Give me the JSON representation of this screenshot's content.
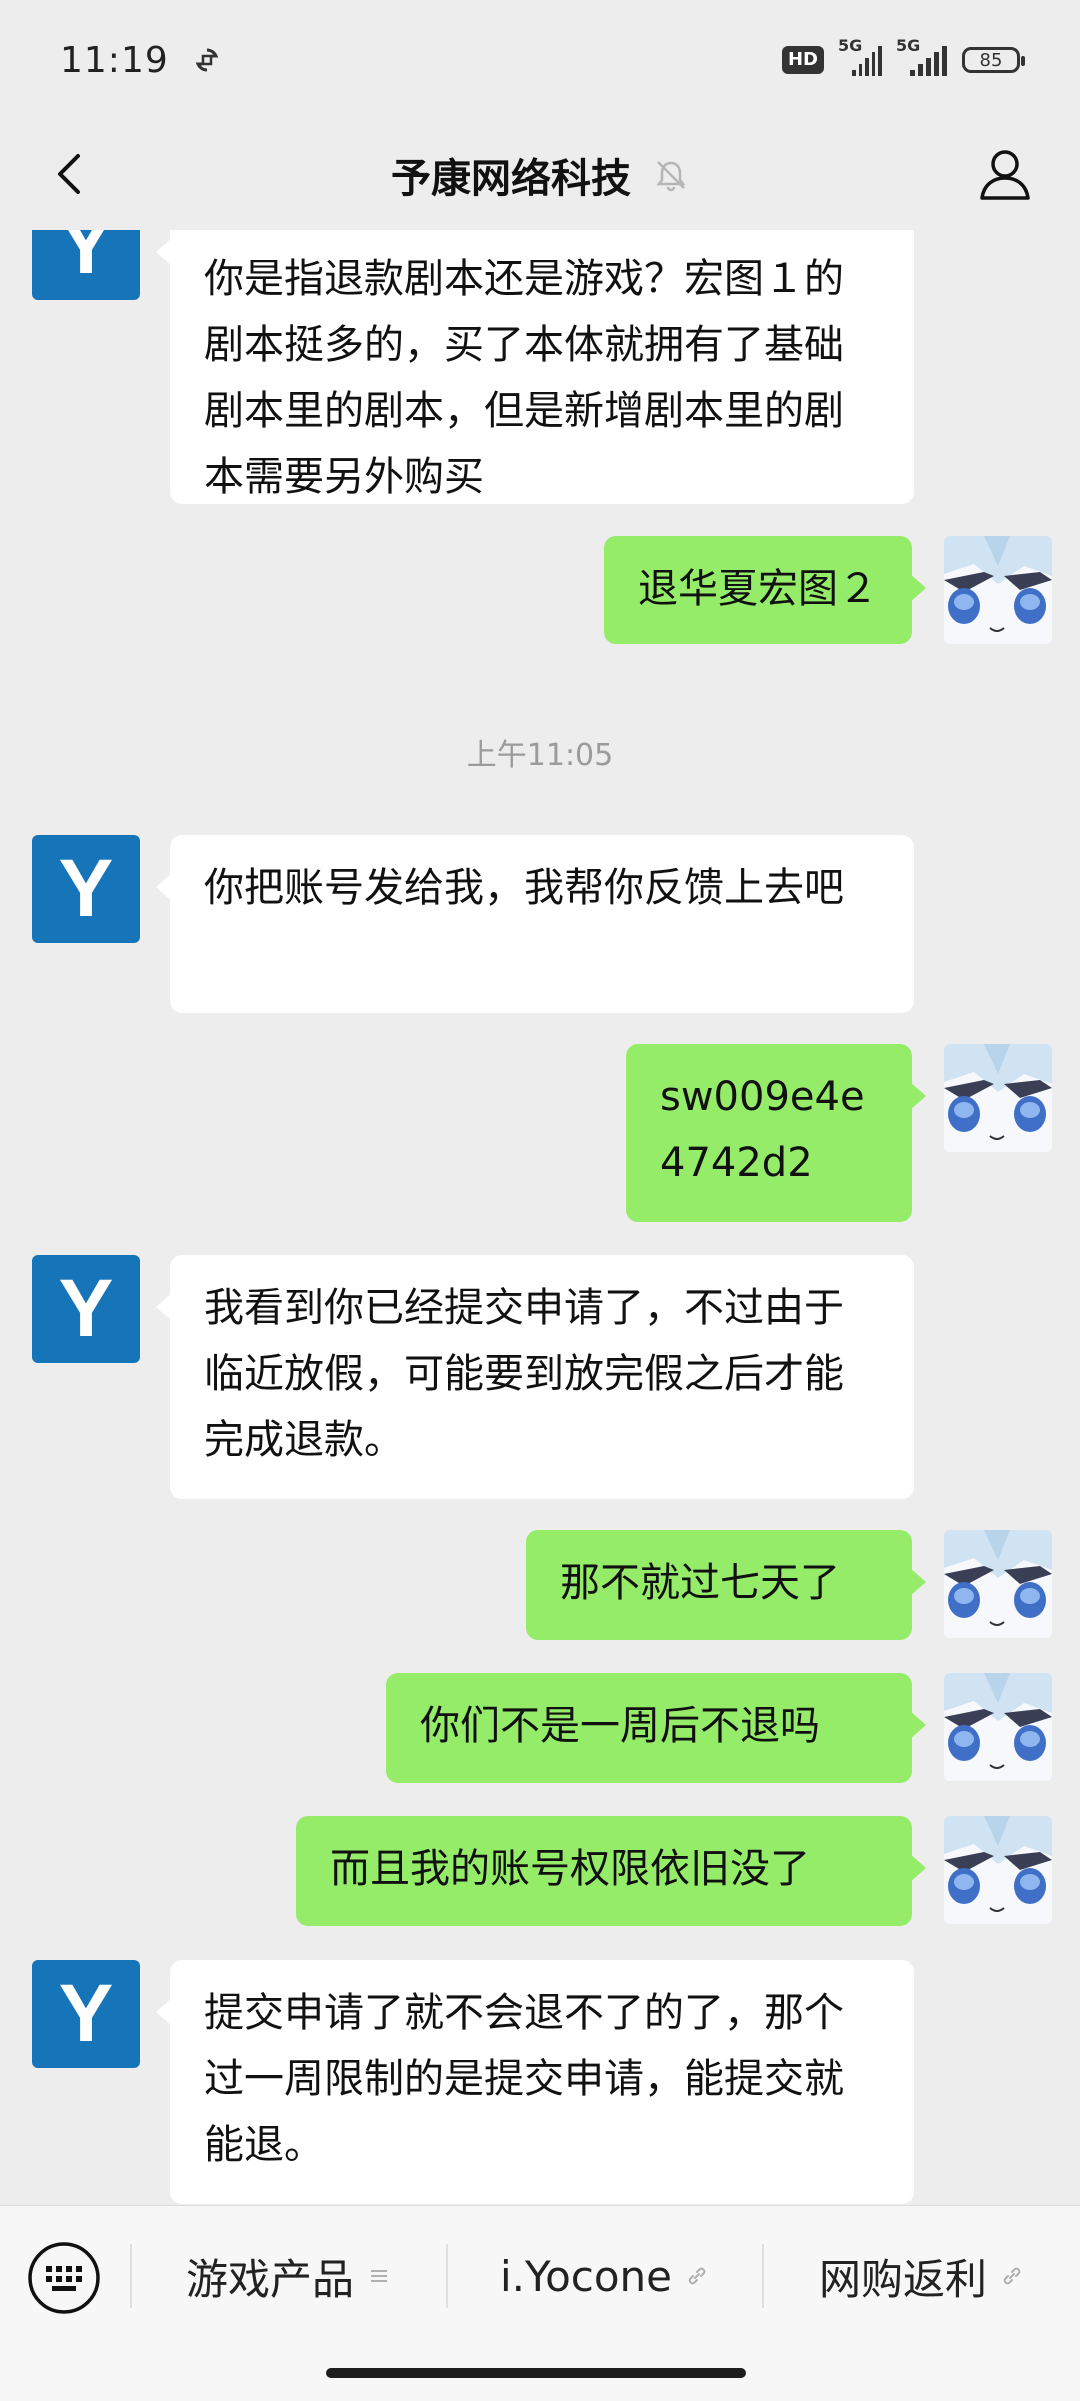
{
  "status_bar": {
    "time": "11:19",
    "hd_label": "HD",
    "sim1_label": "5G",
    "sim2_label": "5G",
    "battery": "85"
  },
  "nav": {
    "title": "予康网络科技"
  },
  "messages": [
    {
      "side": "in",
      "text": "你是指退款剧本还是游戏？宏图１的剧本挺多的，买了本体就拥有了基础剧本里的剧本，但是新增剧本里的剧本需要另外购买"
    },
    {
      "side": "out",
      "text": "退华夏宏图２"
    },
    {
      "side": "in",
      "text": "你把账号发给我，我帮你反馈上去吧"
    },
    {
      "side": "out",
      "text": "sw009e4e4742d2"
    },
    {
      "side": "in",
      "text": "我看到你已经提交申请了，不过由于临近放假，可能要到放完假之后才能完成退款。"
    },
    {
      "side": "out",
      "text": "那不就过七天了"
    },
    {
      "side": "out",
      "text": "你们不是一周后不退吗"
    },
    {
      "side": "out",
      "text": "而且我的账号权限依旧没了"
    },
    {
      "side": "in",
      "text": "提交申请了就不会退不了的了，那个过一周限制的是提交申请，能提交就能退。"
    }
  ],
  "timestamp_1": "上午11:05",
  "avatar_letter": "Y",
  "bottom_menu": {
    "items": [
      {
        "label": "游戏产品",
        "icon": "menu-lines-icon"
      },
      {
        "label": "i.Yocone",
        "icon": "link-icon"
      },
      {
        "label": "网购返利",
        "icon": "link-icon"
      }
    ]
  },
  "colors": {
    "background": "#ededed",
    "outgoing_bubble": "#95ec69",
    "incoming_bubble": "#ffffff",
    "avatar_brand": "#1674b9"
  }
}
